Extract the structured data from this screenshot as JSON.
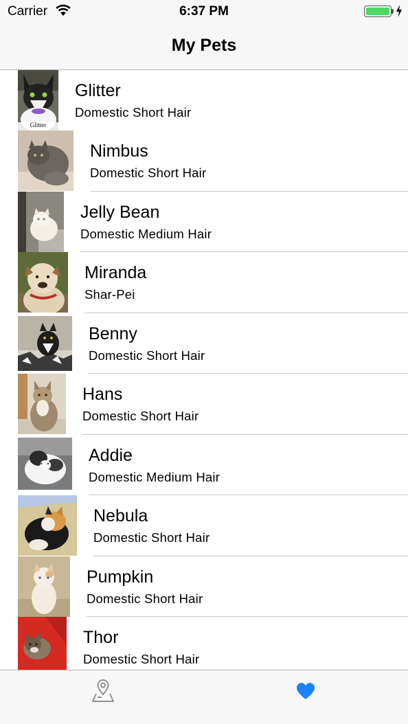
{
  "status_bar": {
    "carrier": "Carrier",
    "time": "6:37 PM",
    "battery_color": "#4cd964"
  },
  "nav": {
    "title": "My Pets"
  },
  "pets": [
    {
      "name": "Glitter",
      "breed": "Domestic Short Hair",
      "photo_caption": "Glitter"
    },
    {
      "name": "Nimbus",
      "breed": "Domestic Short Hair"
    },
    {
      "name": "Jelly Bean",
      "breed": "Domestic Medium Hair"
    },
    {
      "name": "Miranda",
      "breed": "Shar-Pei"
    },
    {
      "name": "Benny",
      "breed": "Domestic Short Hair"
    },
    {
      "name": "Hans",
      "breed": "Domestic Short Hair"
    },
    {
      "name": "Addie",
      "breed": "Domestic Medium Hair"
    },
    {
      "name": "Nebula",
      "breed": "Domestic Short Hair"
    },
    {
      "name": "Pumpkin",
      "breed": "Domestic Short Hair"
    },
    {
      "name": "Thor",
      "breed": "Domestic Short Hair"
    }
  ],
  "tab_bar": {
    "tabs": [
      {
        "icon": "map-pin-icon",
        "selected": false
      },
      {
        "icon": "heart-icon",
        "selected": true
      }
    ],
    "tint_color": "#1a82fb",
    "inactive_color": "#929292"
  }
}
